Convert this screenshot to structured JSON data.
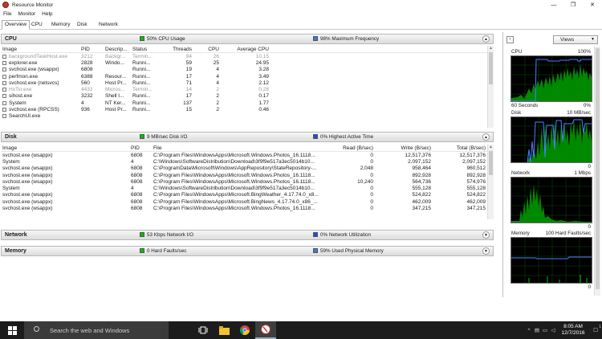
{
  "window": {
    "title": "Resource Monitor",
    "controls": [
      "—",
      "❐",
      "✕"
    ]
  },
  "menu": [
    "File",
    "Monitor",
    "Help"
  ],
  "tabs": [
    "Overview",
    "CPU",
    "Memory",
    "Disk",
    "Network"
  ],
  "sections": {
    "cpu": {
      "title": "CPU",
      "stat1": "50% CPU Usage",
      "stat2": "98% Maximum Frequency",
      "columns": [
        "Image",
        "PID",
        "Descrip...",
        "Status",
        "Threads",
        "CPU",
        "Average CPU"
      ],
      "rows": [
        [
          "backgroundTaskHost.exe",
          "3212",
          "Backgr...",
          "Termin...",
          "94",
          "26",
          "10.15"
        ],
        [
          "explorer.exe",
          "2828",
          "Windo...",
          "Runni...",
          "59",
          "25",
          "24.95"
        ],
        [
          "svchost.exe (wsappx)",
          "6808",
          "",
          "Runni...",
          "19",
          "4",
          "3.28"
        ],
        [
          "perfmon.exe",
          "6388",
          "Resour...",
          "Runni...",
          "17",
          "4",
          "3.49"
        ],
        [
          "svchost.exe (netsvcs)",
          "560",
          "Host Pr...",
          "Runni...",
          "71",
          "4",
          "2.12"
        ],
        [
          "HxTsr.exe",
          "4432",
          "Micros...",
          "Termin...",
          "14",
          "2",
          "0.28"
        ],
        [
          "sihost.exe",
          "3232",
          "Shell I...",
          "Runni...",
          "17",
          "2",
          "0.17"
        ],
        [
          "System",
          "4",
          "NT Ker...",
          "Runni...",
          "137",
          "2",
          "1.77"
        ],
        [
          "svchost.exe (RPCSS)",
          "936",
          "Host Pr...",
          "Runni...",
          "15",
          "2",
          "0.46"
        ],
        [
          "SearchUI.exe",
          "",
          "",
          "",
          "",
          "",
          ""
        ]
      ],
      "dim_rows": [
        0,
        5
      ]
    },
    "disk": {
      "title": "Disk",
      "stat1": "9 MB/sec Disk I/O",
      "stat2": "0% Highest Active Time",
      "columns": [
        "Image",
        "PID",
        "File",
        "Read (B/sec)",
        "Write (B/sec)",
        "Total (B/sec)"
      ],
      "rows": [
        [
          "svchost.exe (wsappx)",
          "6808",
          "C:\\Program Files\\WindowsApps\\Microsoft.Windows.Photos_16.1118...",
          "0",
          "12,517,376",
          "12,517,376"
        ],
        [
          "System",
          "4",
          "C:\\Windows\\SoftwareDistribution\\Download\\3f9f9e517a3ec5014b10...",
          "0",
          "2,097,152",
          "2,097,152"
        ],
        [
          "svchost.exe (wsappx)",
          "6808",
          "C:\\ProgramData\\Microsoft\\Windows\\AppRepository\\StateRepository-...",
          "2,048",
          "958,464",
          "960,512"
        ],
        [
          "svchost.exe (wsappx)",
          "6808",
          "C:\\Program Files\\WindowsApps\\Microsoft.Windows.Photos_16.1118...",
          "0",
          "892,928",
          "892,928"
        ],
        [
          "svchost.exe (wsappx)",
          "6808",
          "C:\\Program Files\\WindowsApps\\Microsoft.Windows.Photos_16.1118...",
          "10,240",
          "564,736",
          "574,976"
        ],
        [
          "System",
          "4",
          "C:\\Windows\\SoftwareDistribution\\Download\\3f9f9e517a3ec5014b10...",
          "0",
          "555,128",
          "555,128"
        ],
        [
          "svchost.exe (wsappx)",
          "6808",
          "C:\\Program Files\\WindowsApps\\Microsoft.BingWeather_4.17.74.0_x8...",
          "0",
          "524,822",
          "524,822"
        ],
        [
          "svchost.exe (wsappx)",
          "6808",
          "C:\\Program Files\\WindowsApps\\Microsoft.BingNews_4.17.74.0_x86_...",
          "0",
          "462,009",
          "462,009"
        ],
        [
          "svchost.exe (wsappx)",
          "6808",
          "C:\\Program Files\\WindowsApps\\Microsoft.Windows.Photos_16.1118...",
          "0",
          "347,215",
          "347,215"
        ]
      ]
    },
    "network": {
      "title": "Network",
      "stat1": "53 Kbps Network I/O",
      "stat2": "0% Network Utilization"
    },
    "memory": {
      "title": "Memory",
      "stat1": "0 Hard Faults/sec",
      "stat2": "59% Used Physical Memory"
    }
  },
  "right_panel": {
    "views_label": "Views",
    "graphs": [
      {
        "name": "CPU",
        "max": "100%",
        "foot_left": "60 Seconds",
        "foot_right": "0%"
      },
      {
        "name": "Disk",
        "max": "10 MB/sec",
        "foot_left": "",
        "foot_right": "0"
      },
      {
        "name": "Network",
        "max": "1 Mbps",
        "foot_left": "",
        "foot_right": "0"
      },
      {
        "name": "Memory",
        "max": "100 Hard Faults/sec",
        "foot_left": "",
        "foot_right": "0"
      }
    ]
  },
  "colors": {
    "green": "#00c000",
    "blue": "#1e4fd8",
    "accent_square_blue": "#3a7bd5",
    "taskbar": "#1c1c1c"
  },
  "taskbar": {
    "search_placeholder": "Search the web and Windows",
    "time": "8:05 AM",
    "date": "12/7/2016",
    "notif_count": "1"
  }
}
